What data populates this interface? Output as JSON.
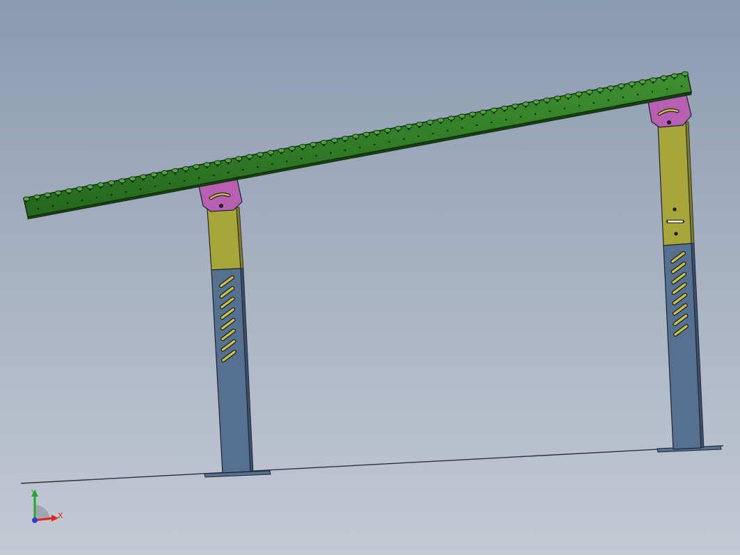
{
  "viewport": {
    "background_top": "#8a9bb0",
    "background_bottom": "#c4c9d4"
  },
  "model": {
    "conveyor_color": "#2e7d25",
    "conveyor_edge": "#0f2a0c",
    "roller_color": "#4fa63d",
    "bracket_color": "#b75fb0",
    "upper_leg_color": "#a8a63a",
    "lower_leg_color": "#56708f",
    "slot_color": "#c9c24a",
    "floor_line_color": "#2c2f35"
  },
  "triad": {
    "x_label": "X",
    "y_label": "Y",
    "x_color": "#e0231b",
    "y_color": "#1fa82a",
    "z_color": "#2b3fc9",
    "x_icon": "x-axis-arrow-icon",
    "y_icon": "y-axis-arrow-icon",
    "origin_icon": "origin-sphere-icon"
  }
}
